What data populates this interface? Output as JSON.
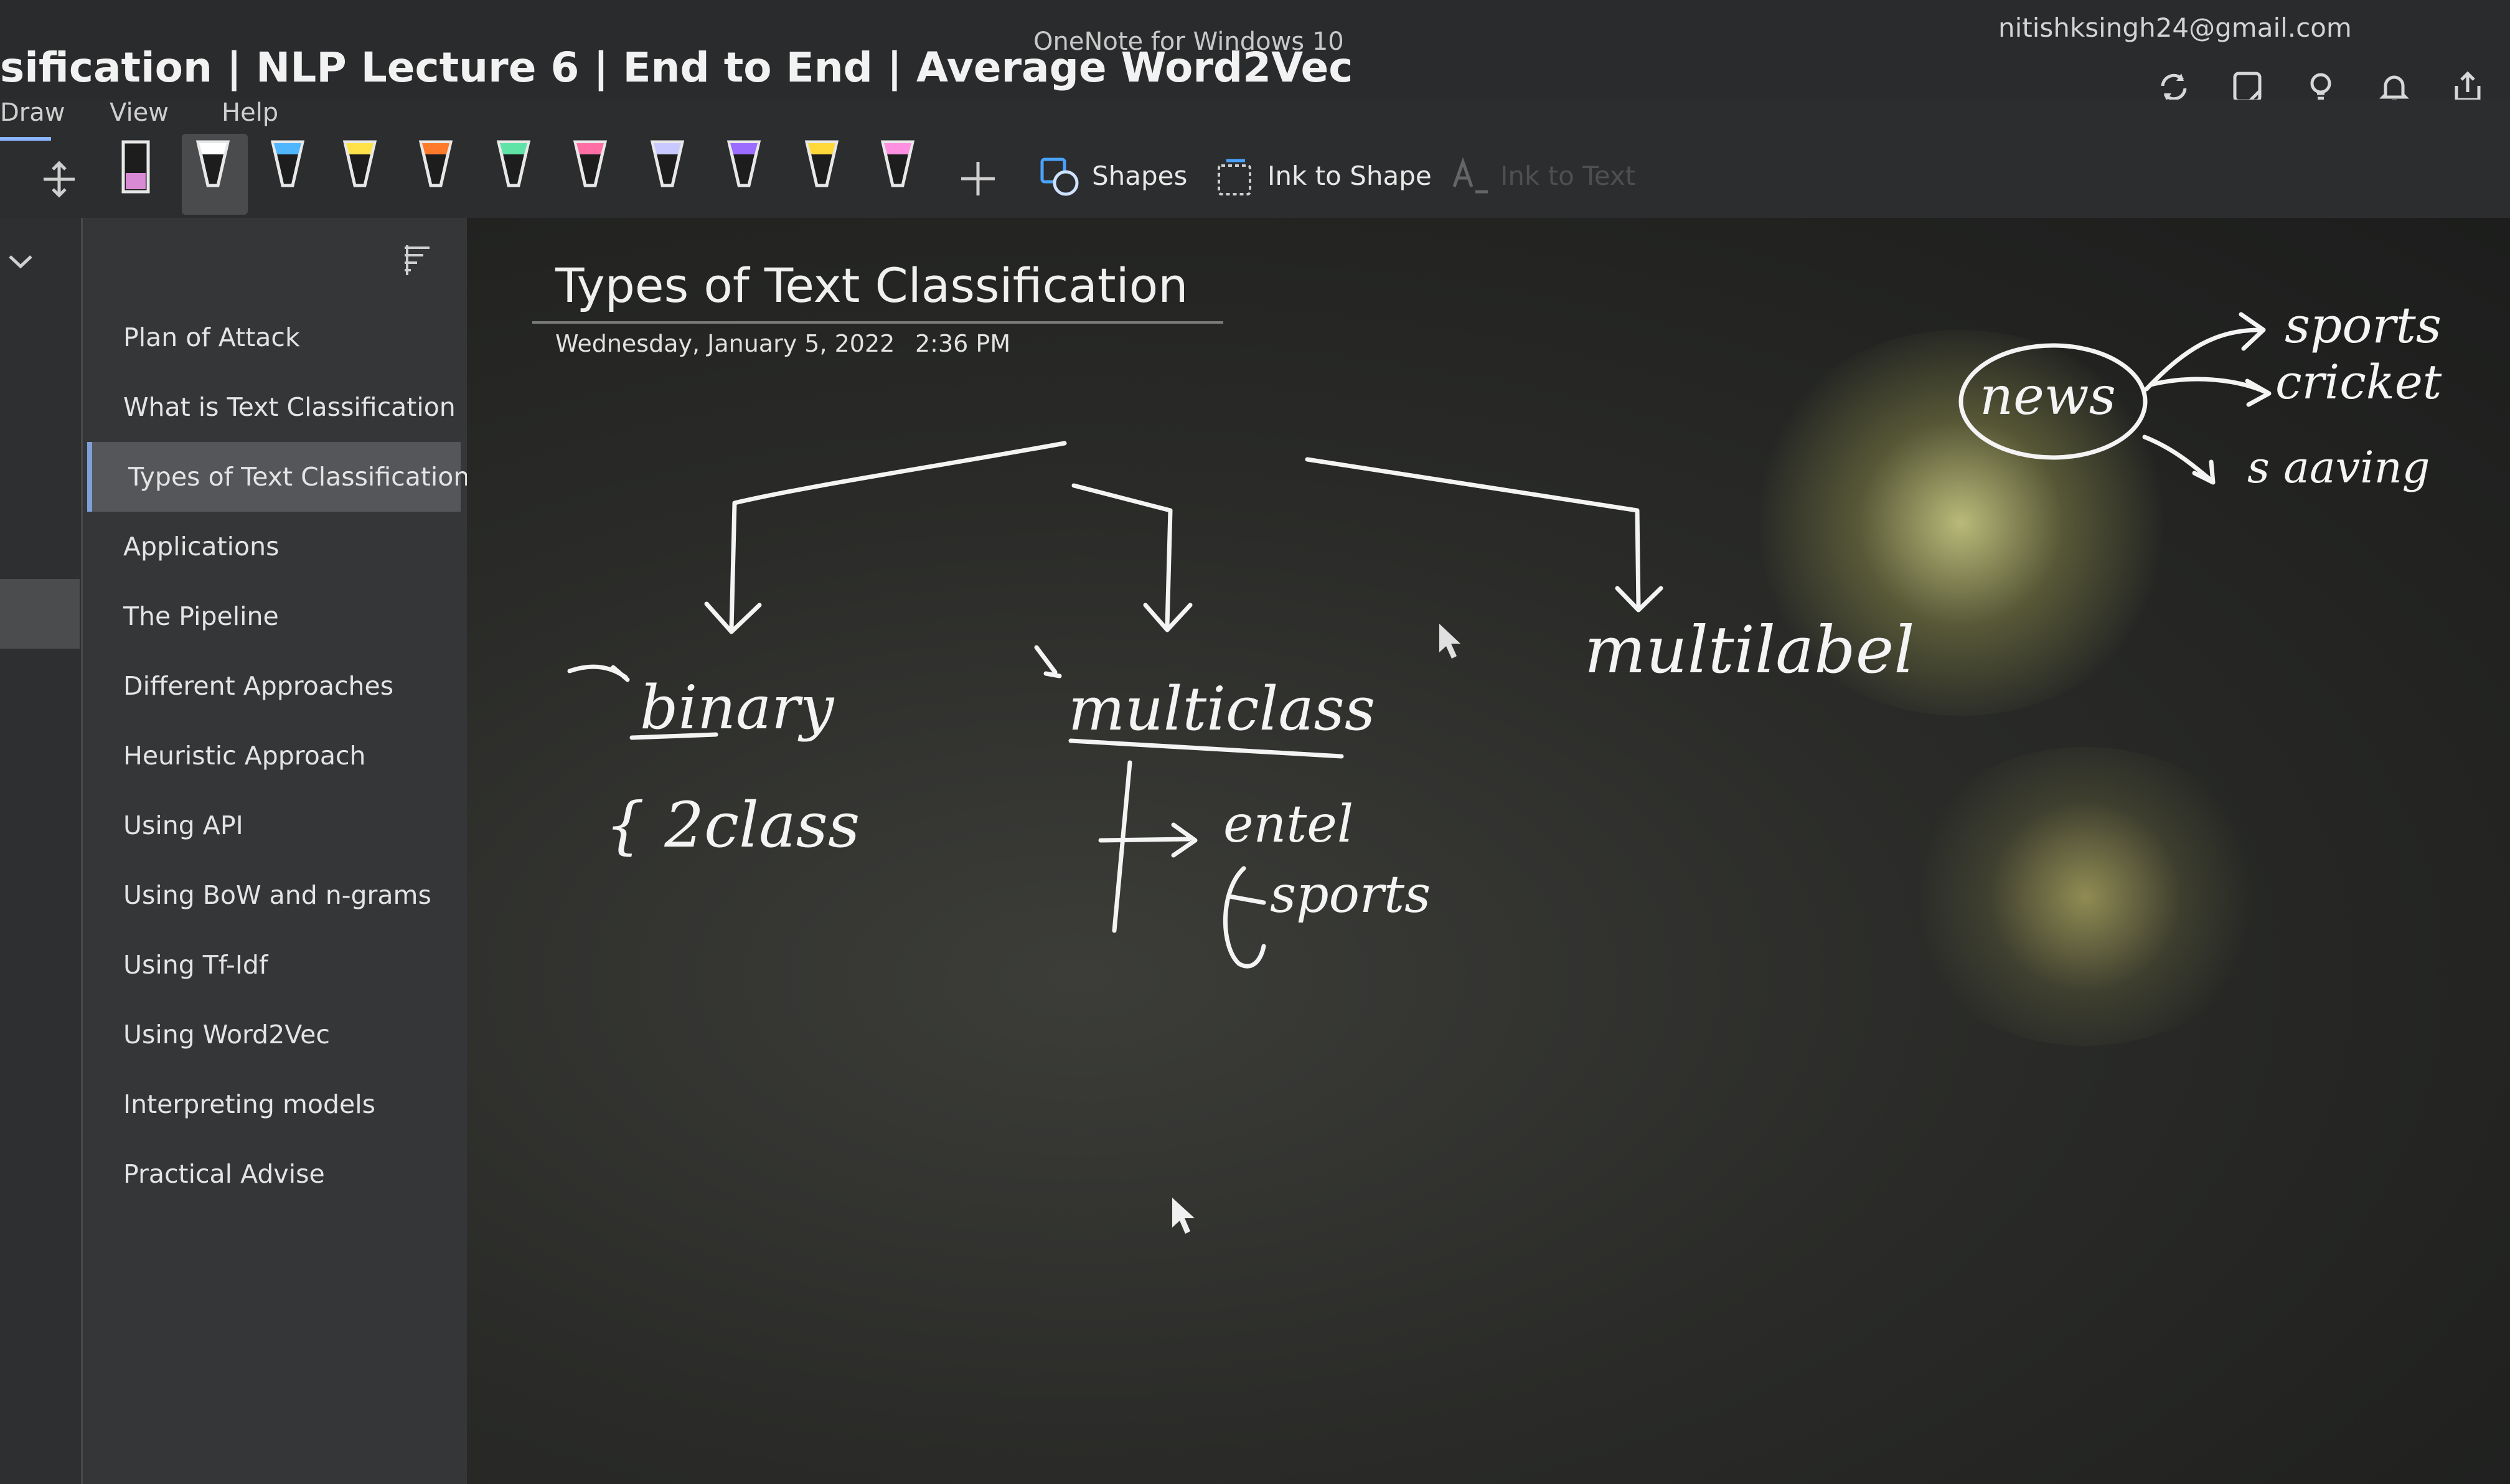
{
  "window": {
    "title": "sification | NLP Lecture 6 | End to End | Average Word2Vec",
    "app_name": "OneNote for Windows 10",
    "account": "nitishksingh24@gmail.com",
    "icons": [
      "sync-icon",
      "notebook-icon",
      "lightbulb-icon",
      "bell-icon",
      "share-icon"
    ]
  },
  "menu": {
    "items": [
      "Draw",
      "View",
      "Help"
    ],
    "active": "Draw"
  },
  "ribbon": {
    "pen_colors": [
      "#d98ad4",
      "#ffffff",
      "#4fb6ff",
      "#ffe24a",
      "#ff7a2a",
      "#5fe3a6",
      "#ff6fa6",
      "#c9c9ff",
      "#9c6bff",
      "#ffd83a",
      "#ff8fe0"
    ],
    "add_pen": "+",
    "shapes_label": "Shapes",
    "ink_to_shape_label": "Ink to Shape",
    "ink_to_text_label": "Ink to Text"
  },
  "sidebar": {
    "pages": [
      "Plan of Attack",
      "What is Text Classification",
      "Types of Text Classification",
      "Applications",
      "The Pipeline",
      "Different Approaches",
      "Heuristic Approach",
      "Using API",
      "Using BoW and n-grams",
      "Using Tf-Idf",
      "Using Word2Vec",
      "Interpreting models",
      "Practical Advise"
    ],
    "selected_page": "Types of Text Classification"
  },
  "page": {
    "title": "Types of Text Classification",
    "date": "Wednesday, January 5, 2022",
    "time": "2:36 PM"
  },
  "ink": {
    "binary": "binary",
    "two_class": "{ 2class",
    "multiclass": "multiclass",
    "entertainment": "entel",
    "sports_branch": "sports",
    "multilabel": "multilabel",
    "news": "news",
    "news_sports": "sports",
    "news_cricket": "cricket",
    "news_economy": "s aaving"
  }
}
